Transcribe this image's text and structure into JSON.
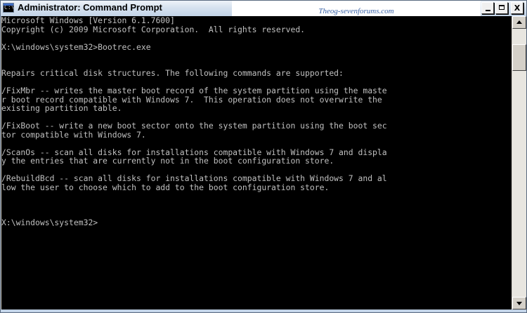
{
  "window": {
    "title": "Administrator: Command Prompt",
    "icon_label": "C:\\",
    "watermark": "Theog-sevenforums.com"
  },
  "controls": {
    "minimize": "minimize-icon",
    "maximize": "maximize-icon",
    "close": "X"
  },
  "console": {
    "lines": [
      "Microsoft Windows [Version 6.1.7600]",
      "Copyright (c) 2009 Microsoft Corporation.  All rights reserved.",
      "",
      "X:\\windows\\system32>Bootrec.exe",
      "",
      "",
      "Repairs critical disk structures. The following commands are supported:",
      "",
      "/FixMbr -- writes the master boot record of the system partition using the maste",
      "r boot record compatible with Windows 7.  This operation does not overwrite the",
      "existing partition table.",
      "",
      "/FixBoot -- write a new boot sector onto the system partition using the boot sec",
      "tor compatible with Windows 7.",
      "",
      "/ScanOs -- scan all disks for installations compatible with Windows 7 and displa",
      "y the entries that are currently not in the boot configuration store.",
      "",
      "/RebuildBcd -- scan all disks for installations compatible with Windows 7 and al",
      "low the user to choose which to add to the boot configuration store.",
      "",
      "",
      "",
      "X:\\windows\\system32>"
    ]
  },
  "colors": {
    "console_bg": "#000000",
    "console_fg": "#c0c0c0",
    "titlebar": "#d6e2ef"
  }
}
